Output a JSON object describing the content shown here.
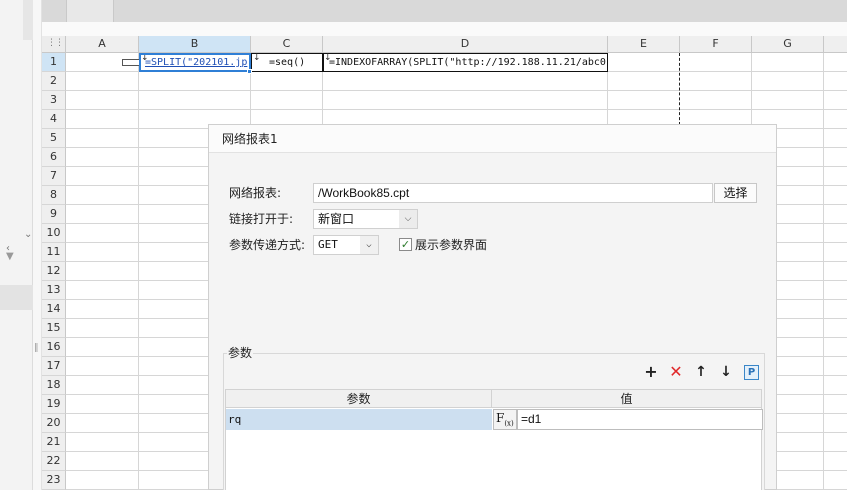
{
  "columns": [
    "A",
    "B",
    "C",
    "D",
    "E",
    "F",
    "G"
  ],
  "rows": [
    "1",
    "2",
    "3",
    "4",
    "5",
    "6",
    "7",
    "8",
    "9",
    "10",
    "11",
    "12",
    "13",
    "14",
    "15",
    "16",
    "17",
    "18",
    "19",
    "20",
    "21",
    "22",
    "23"
  ],
  "selected_column": "B",
  "selected_row": "1",
  "cells": {
    "B1": "=SPLIT(\"202101.jp",
    "C1": "=seq()",
    "D1": "=INDEXOFARRAY(SPLIT(\"http://192.188.11.21/abc0"
  },
  "dialog": {
    "title": "网络报表1",
    "report_label": "网络报表:",
    "report_value": "/WorkBook85.cpt",
    "select_button": "选择",
    "open_in_label": "链接打开于:",
    "open_in_value": "新窗口",
    "method_label": "参数传递方式:",
    "method_value": "GET",
    "show_params_label": "展示参数界面",
    "show_params_checked": true,
    "params_section_title": "参数",
    "params_table": {
      "headers": [
        "参数",
        "值"
      ],
      "rows": [
        {
          "name": "rq",
          "value": "=d1"
        }
      ]
    },
    "tool_icons": [
      "add-icon",
      "delete-icon",
      "move-up-icon",
      "move-down-icon",
      "parameter-icon"
    ],
    "formula_icon_label": "F",
    "formula_icon_sub": "(x)",
    "param_icon_label": "P"
  },
  "colors": {
    "accent": "#2f7fd6",
    "add": "#222222",
    "delete": "#e0282a",
    "selected_row": "#cddff0"
  }
}
